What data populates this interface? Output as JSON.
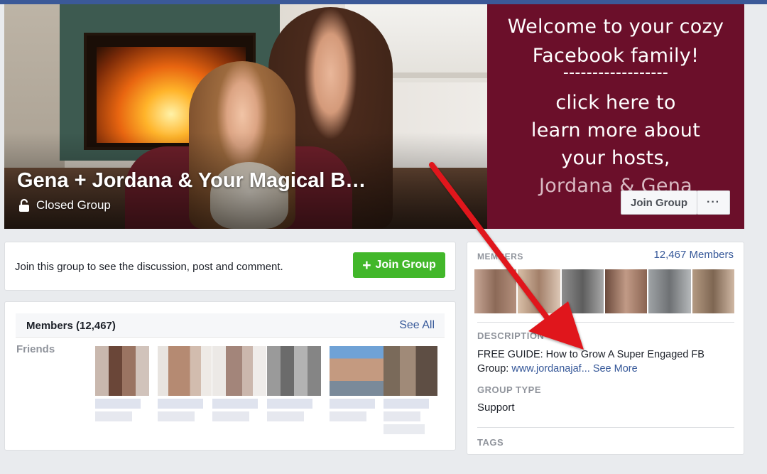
{
  "cover": {
    "title": "Gena + Jordana & Your Magical B…",
    "privacy": "Closed Group",
    "promo_lines": [
      "Welcome to your cozy",
      "Facebook family!",
      "------------------",
      "click here to",
      "learn more about",
      "your hosts,",
      "Jordana & Gena"
    ],
    "join_button": "Join Group",
    "more_button": "···"
  },
  "join_card": {
    "text": "Join this group to see the discussion, post and comment.",
    "button": "Join Group",
    "button_icon": "plus-icon"
  },
  "members_card": {
    "title": "Members (12,467)",
    "see_all": "See All",
    "friends_label": "Friends"
  },
  "about": {
    "members_label": "MEMBERS",
    "members_count": "12,467 Members",
    "description_label": "DESCRIPTION",
    "description_text": "FREE GUIDE: How to Grow A Super Engaged FB Group: ",
    "description_link": "www.jordanajaf...",
    "see_more": "See More",
    "group_type_label": "GROUP TYPE",
    "group_type": "Support",
    "tags_label": "TAGS"
  },
  "colors": {
    "facebook_blue": "#3b5998",
    "link_blue": "#365899",
    "join_green": "#42b72a",
    "promo_maroon": "#6b0f2a",
    "annotation_red": "#e0191b"
  }
}
